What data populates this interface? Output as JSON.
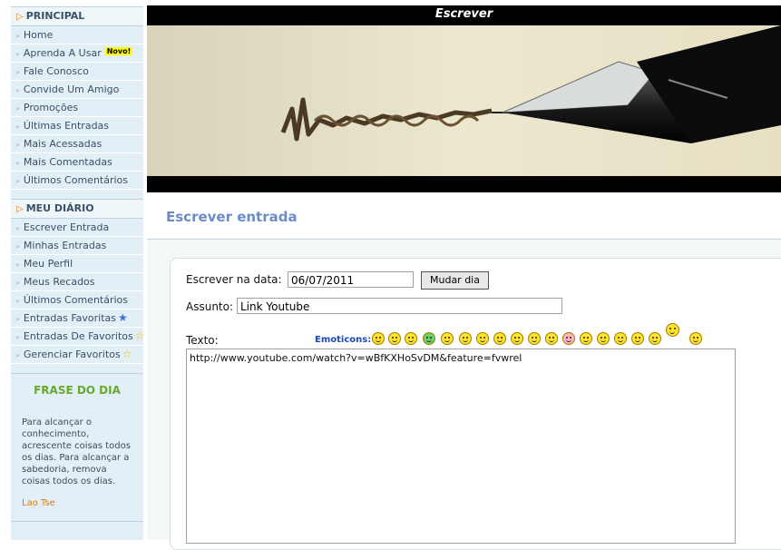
{
  "sidebar": {
    "principal": {
      "title": "PRINCIPAL",
      "items": [
        {
          "label": "Home"
        },
        {
          "label": "Aprenda A Usar",
          "badge": "Novo!"
        },
        {
          "label": "Fale Conosco"
        },
        {
          "label": "Convide Um Amigo"
        },
        {
          "label": "Promoções"
        },
        {
          "label": "Últimas Entradas"
        },
        {
          "label": "Mais Acessadas"
        },
        {
          "label": "Mais Comentadas"
        },
        {
          "label": "Últimos Comentários"
        }
      ]
    },
    "diario": {
      "title": "MEU DIÁRIO",
      "items": [
        {
          "label": "Escrever Entrada"
        },
        {
          "label": "Minhas Entradas"
        },
        {
          "label": "Meu Perfil"
        },
        {
          "label": "Meus Recados"
        },
        {
          "label": "Últimos Comentários"
        },
        {
          "label": "Entradas Favoritas",
          "icon": "blue-star-icon"
        },
        {
          "label": "Entradas De Favoritos",
          "icon": "yellow-star-icon"
        },
        {
          "label": "Gerenciar Favoritos",
          "icon": "yellow-star-icon"
        }
      ]
    },
    "frase": {
      "title": "FRASE DO DIA",
      "text": "Para alcançar o conhecimento, acrescente coisas todos os dias. Para alcançar a sabedoria, remova coisas todos os dias.",
      "author": "Lao Tse"
    }
  },
  "banner": {
    "title": "Escrever",
    "image": "fountain-pen-writing-image"
  },
  "page": {
    "title": "Escrever entrada"
  },
  "form": {
    "date_label": "Escrever na data:",
    "date_value": "06/07/2011",
    "change_day_label": "Mudar dia",
    "subject_label": "Assunto:",
    "subject_value": "Link Youtube",
    "text_label": "Texto:",
    "emoticons_label": "Emoticons:",
    "text_value": "http://www.youtube.com/watch?v=wBfKXHoSvDM&feature=fvwrel"
  },
  "colors": {
    "accent": "#6d8bc9",
    "sidebar_bg": "#e3eff6",
    "frase_title": "#67a92e",
    "author": "#e07a10"
  },
  "emoticons": [
    "smile",
    "grin",
    "sad",
    "teeth",
    "surprised",
    "confused",
    "question",
    "cool",
    "laugh",
    "wink",
    "tongue",
    "blush",
    "sick",
    "devil",
    "rolleyes",
    "smirk",
    "neutral",
    "thinking",
    "thumbs-up",
    "thumbs-up-grin"
  ]
}
